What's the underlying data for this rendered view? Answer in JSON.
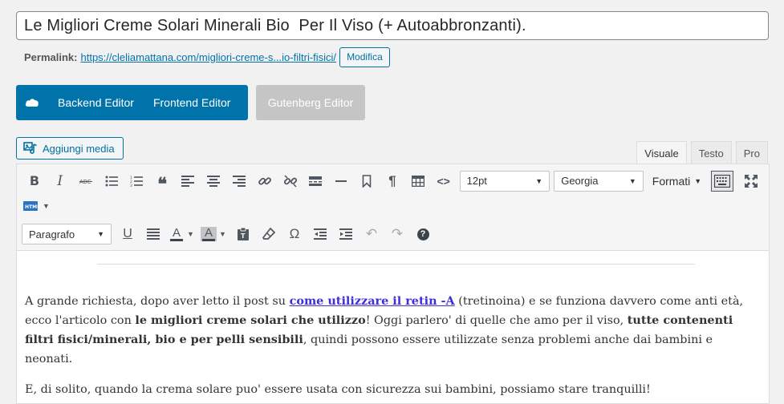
{
  "post": {
    "title": "Le Migliori Creme Solari Minerali Bio  Per Il Viso (+ Autoabbronzanti).",
    "permalink_label": "Permalink:",
    "permalink_url": "https://cleliamattana.com/migliori-creme-s...io-filtri-fisici/",
    "edit_button": "Modifica"
  },
  "editor_switch": {
    "backend": "Backend Editor",
    "frontend": "Frontend Editor",
    "gutenberg": "Gutenberg Editor"
  },
  "media": {
    "add_media": "Aggiungi media"
  },
  "tabs": [
    "Visuale",
    "Testo",
    "Pro"
  ],
  "toolbar": {
    "font_size": "12pt",
    "font_family": "Georgia",
    "formats": "Formati",
    "paragraph": "Paragrafo"
  },
  "content": {
    "p1_a": "A grande richiesta, dopo aver letto il post su ",
    "p1_link": "come utilizzare il retin -A",
    "p1_b": " (tretinoina) e se funziona davvero come anti età, ecco l'articolo con ",
    "p1_bold1": "le migliori creme solari che utilizzo",
    "p1_c": "! Oggi parlero' di quelle che amo per il viso, ",
    "p1_bold2": "tutte contenenti filtri fisici/minerali, bio e per pelli sensibili",
    "p1_d": ", quindi possono essere utilizzate senza problemi anche dai bambini e neonati.",
    "p2": "E, di solito, quando la crema solare puo' essere usata con sicurezza sui bambini, possiamo stare tranquilli!"
  },
  "colors": {
    "accent": "#0073aa",
    "link": "#3d2ed8",
    "disabled": "#c5c5c5"
  }
}
